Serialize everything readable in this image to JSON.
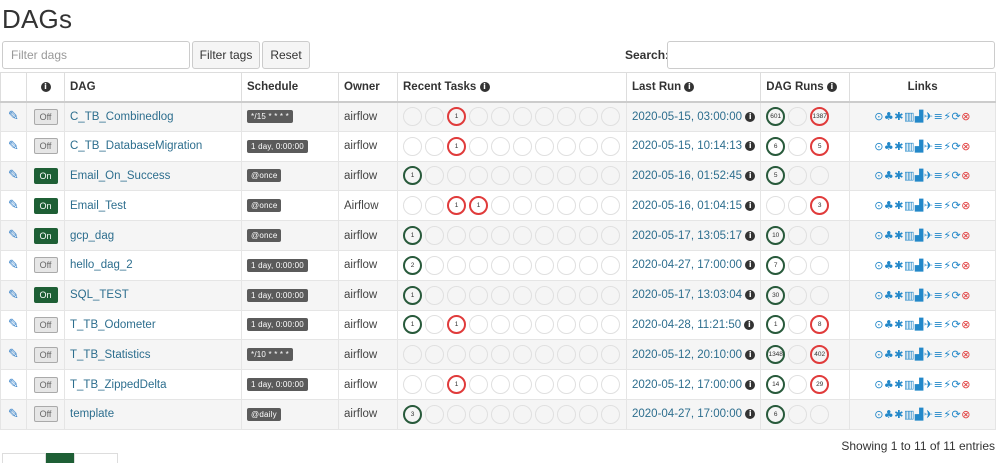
{
  "page": {
    "title": "DAGs"
  },
  "toolbar": {
    "filter_placeholder": "Filter dags",
    "filter_tags_label": "Filter tags",
    "reset_label": "Reset",
    "search_label": "Search:",
    "search_value": ""
  },
  "table": {
    "headers": {
      "info": "i",
      "dag": "DAG",
      "schedule": "Schedule",
      "owner": "Owner",
      "recent_tasks": "Recent Tasks",
      "last_run": "Last Run",
      "dag_runs": "DAG Runs",
      "links": "Links"
    },
    "rows": [
      {
        "toggle": "Off",
        "dag": "C_TB_Combinedlog",
        "schedule": "*/15 * * * *",
        "owner": "airflow",
        "last_run": "2020-05-15, 03:00:00",
        "recent_tasks": [
          {
            "s": "other",
            "n": ""
          },
          {
            "s": "other",
            "n": ""
          },
          {
            "s": "fail",
            "n": "1"
          },
          {
            "s": "other",
            "n": ""
          },
          {
            "s": "other",
            "n": ""
          },
          {
            "s": "other",
            "n": ""
          },
          {
            "s": "other",
            "n": ""
          },
          {
            "s": "other",
            "n": ""
          },
          {
            "s": "other",
            "n": ""
          },
          {
            "s": "other",
            "n": ""
          }
        ],
        "dag_runs": [
          {
            "s": "succ",
            "n": "601"
          },
          {
            "s": "other",
            "n": ""
          },
          {
            "s": "fail",
            "n": "1387"
          }
        ]
      },
      {
        "toggle": "Off",
        "dag": "C_TB_DatabaseMigration",
        "schedule": "1 day, 0:00:00",
        "owner": "airflow",
        "last_run": "2020-05-15, 10:14:13",
        "recent_tasks": [
          {
            "s": "other",
            "n": ""
          },
          {
            "s": "other",
            "n": ""
          },
          {
            "s": "fail",
            "n": "1"
          },
          {
            "s": "other",
            "n": ""
          },
          {
            "s": "other",
            "n": ""
          },
          {
            "s": "other",
            "n": ""
          },
          {
            "s": "other",
            "n": ""
          },
          {
            "s": "other",
            "n": ""
          },
          {
            "s": "other",
            "n": ""
          },
          {
            "s": "other",
            "n": ""
          }
        ],
        "dag_runs": [
          {
            "s": "succ",
            "n": "6"
          },
          {
            "s": "other",
            "n": ""
          },
          {
            "s": "fail",
            "n": "5"
          }
        ]
      },
      {
        "toggle": "On",
        "dag": "Email_On_Success",
        "schedule": "@once",
        "owner": "airflow",
        "last_run": "2020-05-16, 01:52:45",
        "recent_tasks": [
          {
            "s": "succ",
            "n": "1"
          },
          {
            "s": "other",
            "n": ""
          },
          {
            "s": "other",
            "n": ""
          },
          {
            "s": "other",
            "n": ""
          },
          {
            "s": "other",
            "n": ""
          },
          {
            "s": "other",
            "n": ""
          },
          {
            "s": "other",
            "n": ""
          },
          {
            "s": "other",
            "n": ""
          },
          {
            "s": "other",
            "n": ""
          },
          {
            "s": "other",
            "n": ""
          }
        ],
        "dag_runs": [
          {
            "s": "succ",
            "n": "5"
          },
          {
            "s": "other",
            "n": ""
          },
          {
            "s": "other",
            "n": ""
          }
        ]
      },
      {
        "toggle": "On",
        "dag": "Email_Test",
        "schedule": "@once",
        "owner": "Airflow",
        "last_run": "2020-05-16, 01:04:15",
        "recent_tasks": [
          {
            "s": "other",
            "n": ""
          },
          {
            "s": "other",
            "n": ""
          },
          {
            "s": "fail",
            "n": "1"
          },
          {
            "s": "fail",
            "n": "1"
          },
          {
            "s": "other",
            "n": ""
          },
          {
            "s": "other",
            "n": ""
          },
          {
            "s": "other",
            "n": ""
          },
          {
            "s": "other",
            "n": ""
          },
          {
            "s": "other",
            "n": ""
          },
          {
            "s": "other",
            "n": ""
          }
        ],
        "dag_runs": [
          {
            "s": "other",
            "n": ""
          },
          {
            "s": "other",
            "n": ""
          },
          {
            "s": "fail",
            "n": "3"
          }
        ]
      },
      {
        "toggle": "On",
        "dag": "gcp_dag",
        "schedule": "@once",
        "owner": "airflow",
        "last_run": "2020-05-17, 13:05:17",
        "recent_tasks": [
          {
            "s": "succ",
            "n": "1"
          },
          {
            "s": "other",
            "n": ""
          },
          {
            "s": "other",
            "n": ""
          },
          {
            "s": "other",
            "n": ""
          },
          {
            "s": "other",
            "n": ""
          },
          {
            "s": "other",
            "n": ""
          },
          {
            "s": "other",
            "n": ""
          },
          {
            "s": "other",
            "n": ""
          },
          {
            "s": "other",
            "n": ""
          },
          {
            "s": "other",
            "n": ""
          }
        ],
        "dag_runs": [
          {
            "s": "succ",
            "n": "10"
          },
          {
            "s": "other",
            "n": ""
          },
          {
            "s": "other",
            "n": ""
          }
        ]
      },
      {
        "toggle": "Off",
        "dag": "hello_dag_2",
        "schedule": "1 day, 0:00:00",
        "owner": "airflow",
        "last_run": "2020-04-27, 17:00:00",
        "recent_tasks": [
          {
            "s": "succ",
            "n": "2"
          },
          {
            "s": "other",
            "n": ""
          },
          {
            "s": "other",
            "n": ""
          },
          {
            "s": "other",
            "n": ""
          },
          {
            "s": "other",
            "n": ""
          },
          {
            "s": "other",
            "n": ""
          },
          {
            "s": "other",
            "n": ""
          },
          {
            "s": "other",
            "n": ""
          },
          {
            "s": "other",
            "n": ""
          },
          {
            "s": "other",
            "n": ""
          }
        ],
        "dag_runs": [
          {
            "s": "succ",
            "n": "7"
          },
          {
            "s": "other",
            "n": ""
          },
          {
            "s": "other",
            "n": ""
          }
        ]
      },
      {
        "toggle": "On",
        "dag": "SQL_TEST",
        "schedule": "1 day, 0:00:00",
        "owner": "airflow",
        "last_run": "2020-05-17, 13:03:04",
        "recent_tasks": [
          {
            "s": "succ",
            "n": "1"
          },
          {
            "s": "other",
            "n": ""
          },
          {
            "s": "other",
            "n": ""
          },
          {
            "s": "other",
            "n": ""
          },
          {
            "s": "other",
            "n": ""
          },
          {
            "s": "other",
            "n": ""
          },
          {
            "s": "other",
            "n": ""
          },
          {
            "s": "other",
            "n": ""
          },
          {
            "s": "other",
            "n": ""
          },
          {
            "s": "other",
            "n": ""
          }
        ],
        "dag_runs": [
          {
            "s": "succ",
            "n": "30"
          },
          {
            "s": "other",
            "n": ""
          },
          {
            "s": "other",
            "n": ""
          }
        ]
      },
      {
        "toggle": "Off",
        "dag": "T_TB_Odometer",
        "schedule": "1 day, 0:00:00",
        "owner": "airflow",
        "last_run": "2020-04-28, 11:21:50",
        "recent_tasks": [
          {
            "s": "succ",
            "n": "1"
          },
          {
            "s": "other",
            "n": ""
          },
          {
            "s": "fail",
            "n": "1"
          },
          {
            "s": "other",
            "n": ""
          },
          {
            "s": "other",
            "n": ""
          },
          {
            "s": "other",
            "n": ""
          },
          {
            "s": "other",
            "n": ""
          },
          {
            "s": "other",
            "n": ""
          },
          {
            "s": "other",
            "n": ""
          },
          {
            "s": "other",
            "n": ""
          }
        ],
        "dag_runs": [
          {
            "s": "succ",
            "n": "1"
          },
          {
            "s": "other",
            "n": ""
          },
          {
            "s": "fail",
            "n": "8"
          }
        ]
      },
      {
        "toggle": "Off",
        "dag": "T_TB_Statistics",
        "schedule": "*/10 * * * *",
        "owner": "airflow",
        "last_run": "2020-05-12, 20:10:00",
        "recent_tasks": [
          {
            "s": "other",
            "n": ""
          },
          {
            "s": "other",
            "n": ""
          },
          {
            "s": "other",
            "n": ""
          },
          {
            "s": "other",
            "n": ""
          },
          {
            "s": "other",
            "n": ""
          },
          {
            "s": "other",
            "n": ""
          },
          {
            "s": "other",
            "n": ""
          },
          {
            "s": "other",
            "n": ""
          },
          {
            "s": "other",
            "n": ""
          },
          {
            "s": "other",
            "n": ""
          }
        ],
        "dag_runs": [
          {
            "s": "succ",
            "n": "1348"
          },
          {
            "s": "other",
            "n": ""
          },
          {
            "s": "fail",
            "n": "402"
          }
        ]
      },
      {
        "toggle": "Off",
        "dag": "T_TB_ZippedDelta",
        "schedule": "1 day, 0:00:00",
        "owner": "airflow",
        "last_run": "2020-05-12, 17:00:00",
        "recent_tasks": [
          {
            "s": "other",
            "n": ""
          },
          {
            "s": "other",
            "n": ""
          },
          {
            "s": "fail",
            "n": "1"
          },
          {
            "s": "other",
            "n": ""
          },
          {
            "s": "other",
            "n": ""
          },
          {
            "s": "other",
            "n": ""
          },
          {
            "s": "other",
            "n": ""
          },
          {
            "s": "other",
            "n": ""
          },
          {
            "s": "other",
            "n": ""
          },
          {
            "s": "other",
            "n": ""
          }
        ],
        "dag_runs": [
          {
            "s": "succ",
            "n": "14"
          },
          {
            "s": "other",
            "n": ""
          },
          {
            "s": "fail",
            "n": "29"
          }
        ]
      },
      {
        "toggle": "Off",
        "dag": "template",
        "schedule": "@daily",
        "owner": "airflow",
        "last_run": "2020-04-27, 17:00:00",
        "recent_tasks": [
          {
            "s": "succ",
            "n": "3"
          },
          {
            "s": "other",
            "n": ""
          },
          {
            "s": "other",
            "n": ""
          },
          {
            "s": "other",
            "n": ""
          },
          {
            "s": "other",
            "n": ""
          },
          {
            "s": "other",
            "n": ""
          },
          {
            "s": "other",
            "n": ""
          },
          {
            "s": "other",
            "n": ""
          },
          {
            "s": "other",
            "n": ""
          },
          {
            "s": "other",
            "n": ""
          }
        ],
        "dag_runs": [
          {
            "s": "succ",
            "n": "6"
          },
          {
            "s": "other",
            "n": ""
          },
          {
            "s": "other",
            "n": ""
          }
        ]
      }
    ],
    "link_icons": [
      "trigger-dag-icon",
      "tree-view-icon",
      "graph-view-icon",
      "tries-icon",
      "landing-times-icon",
      "gantt-icon",
      "code-icon",
      "logs-icon",
      "refresh-icon",
      "delete-icon"
    ],
    "link_glyphs": [
      "⊙",
      "♣",
      "✱",
      "▥",
      "▟",
      "✈",
      "≡",
      "⚡",
      "⟳",
      "⊗"
    ]
  },
  "footer": {
    "info": "Showing 1 to 11 of 11 entries"
  },
  "colors": {
    "success": "#285a3b",
    "failed": "#e03b3b",
    "link": "#2d6e8e",
    "toggle_on": "#1e5f35"
  }
}
